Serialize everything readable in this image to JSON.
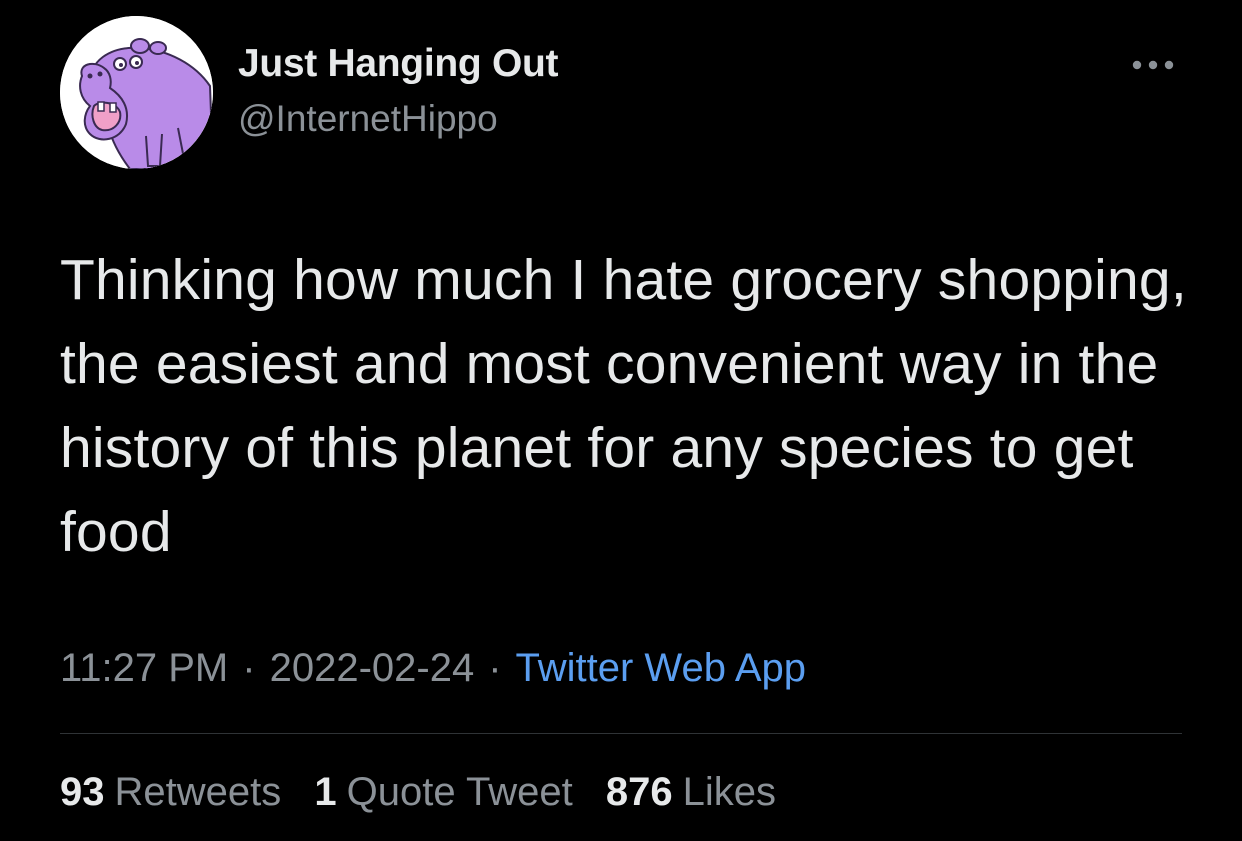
{
  "user": {
    "display_name": "Just Hanging Out",
    "handle": "@InternetHippo",
    "avatar_icon": "purple-hippo-avatar"
  },
  "tweet": {
    "text": "Thinking how much I hate grocery shopping, the easiest and most convenient way in the history of this planet for any species to get food",
    "time": "11:27 PM",
    "date": "2022-02-24",
    "separator": "·",
    "source": "Twitter Web App"
  },
  "stats": {
    "retweets_count": "93",
    "retweets_label": "Retweets",
    "quotes_count": "1",
    "quotes_label": "Quote Tweet",
    "likes_count": "876",
    "likes_label": "Likes"
  },
  "colors": {
    "background": "#000000",
    "primary_text": "#e7e9ea",
    "secondary_text": "#8b9197",
    "link": "#5b9ef0",
    "divider": "#2f3336",
    "avatar_hippo": "#b98be8"
  },
  "icons": {
    "more": "more-horizontal-icon"
  }
}
